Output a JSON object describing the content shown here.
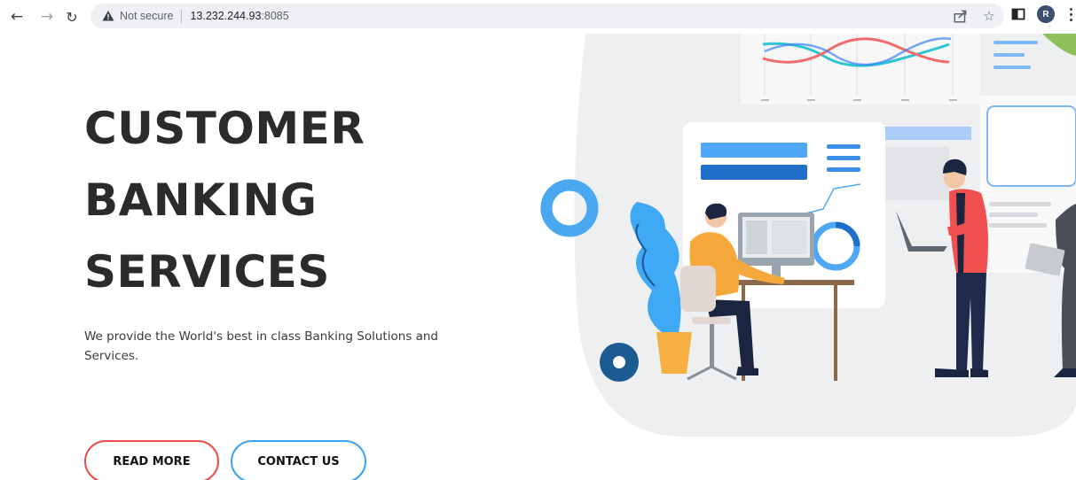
{
  "browser": {
    "security_label": "Not secure",
    "url_host": "13.232.244.93",
    "url_port": ":8085",
    "profile_initial": "R"
  },
  "hero": {
    "title_lines": [
      "CUSTOMER",
      "BANKING",
      "SERVICES"
    ],
    "subtitle": "We provide the World's best in class Banking Solutions and Services."
  },
  "buttons": {
    "read_more": "READ MORE",
    "contact_us": "CONTACT US"
  },
  "colors": {
    "primary_button_border": "#f04a4a",
    "secondary_button_border": "#3aa3f2",
    "accent_blue": "#3aa3f2",
    "accent_dark_blue": "#1c5a92",
    "accent_orange": "#f5b041"
  }
}
